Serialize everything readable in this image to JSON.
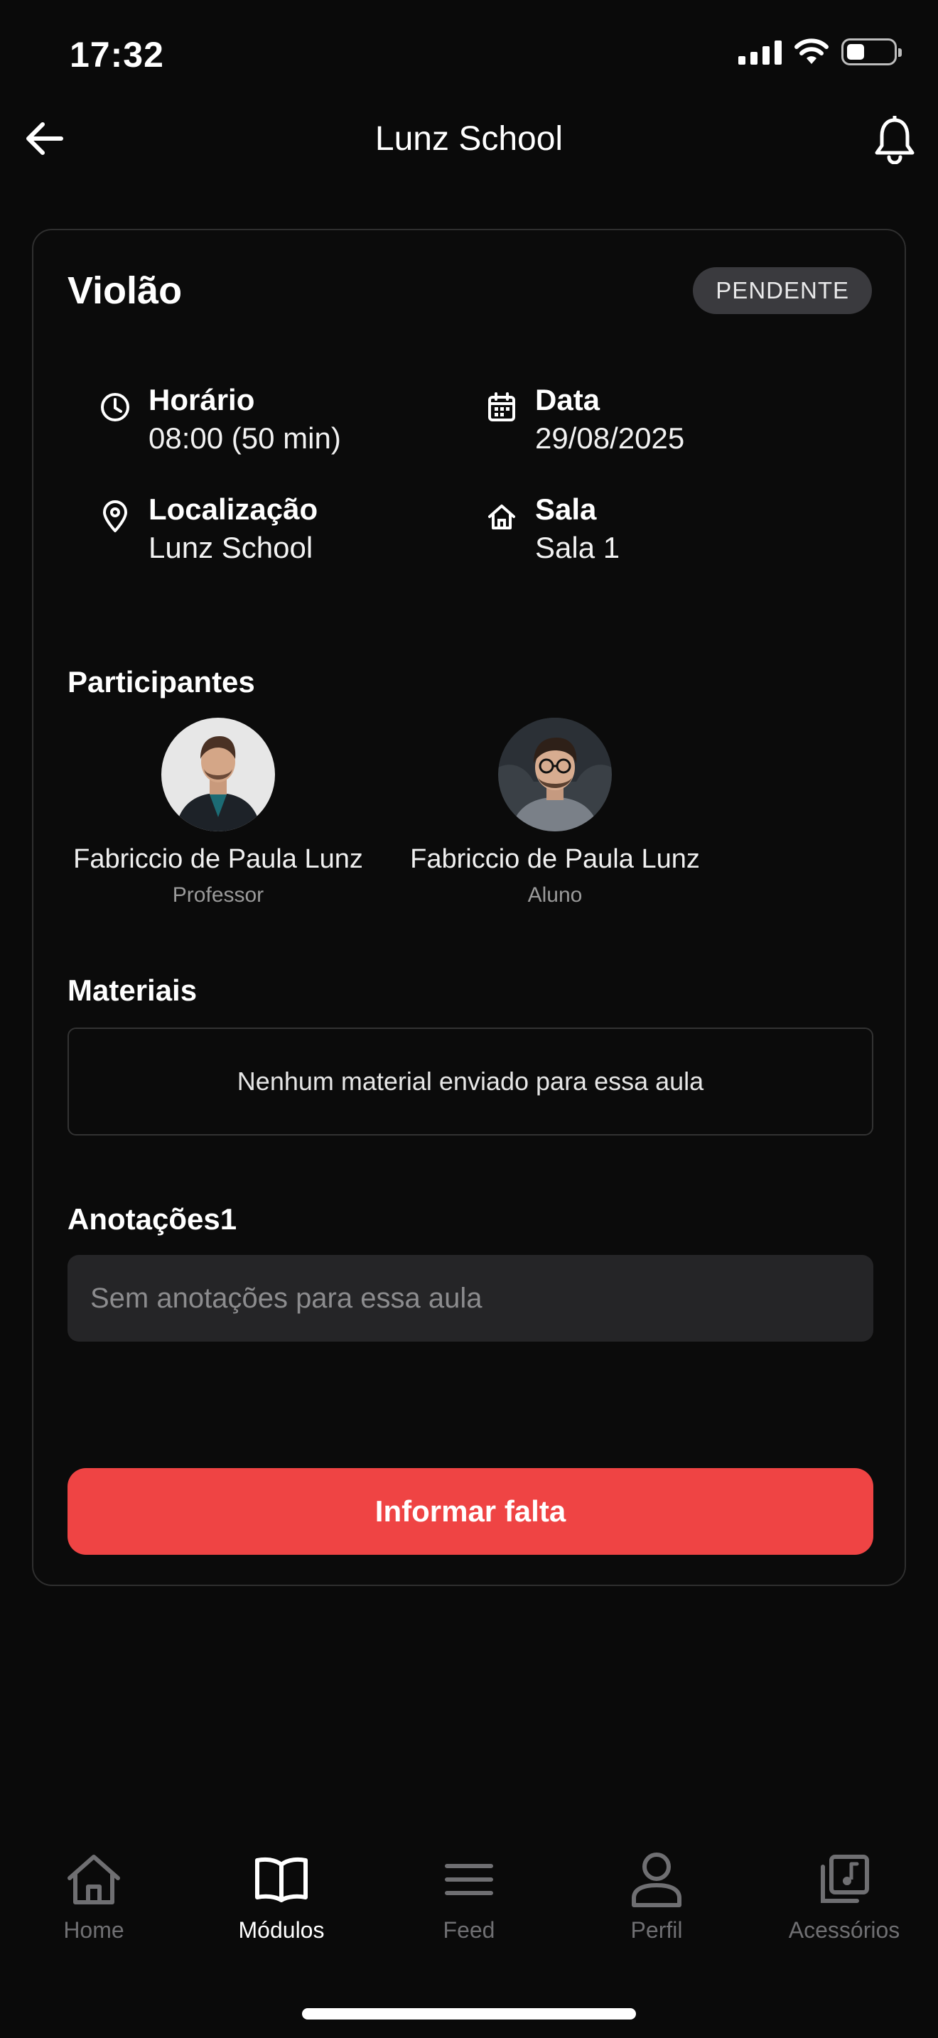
{
  "status_bar": {
    "time": "17:32"
  },
  "app_bar": {
    "title": "Lunz School"
  },
  "lesson": {
    "title": "Violão",
    "status": "PENDENTE",
    "schedule_label": "Horário",
    "schedule_value": "08:00 (50 min)",
    "date_label": "Data",
    "date_value": "29/08/2025",
    "location_label": "Localização",
    "location_value": "Lunz School",
    "room_label": "Sala",
    "room_value": "Sala 1"
  },
  "participants": {
    "title": "Participantes",
    "items": [
      {
        "name": "Fabriccio de Paula Lunz",
        "role": "Professor"
      },
      {
        "name": "Fabriccio de Paula Lunz",
        "role": "Aluno"
      }
    ]
  },
  "materials": {
    "title": "Materiais",
    "empty_text": "Nenhum material enviado para essa aula"
  },
  "notes": {
    "title": "Anotações1",
    "placeholder": "Sem anotações para essa aula"
  },
  "actions": {
    "report_absence": "Informar falta"
  },
  "bottom_nav": {
    "items": [
      {
        "label": "Home",
        "icon": "home-icon",
        "active": false
      },
      {
        "label": "Módulos",
        "icon": "book-icon",
        "active": true
      },
      {
        "label": "Feed",
        "icon": "menu-lines-icon",
        "active": false
      },
      {
        "label": "Perfil",
        "icon": "person-icon",
        "active": false
      },
      {
        "label": "Acessórios",
        "icon": "music-library-icon",
        "active": false
      }
    ]
  },
  "colors": {
    "accent": "#ef4444",
    "background": "#0a0a0a",
    "badge": "#3a3a3e",
    "input": "#252527"
  }
}
